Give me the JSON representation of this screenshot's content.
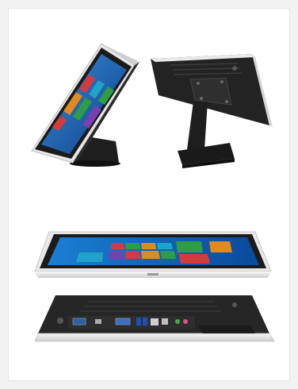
{
  "product": {
    "views": [
      {
        "name": "angled-front-view"
      },
      {
        "name": "angled-rear-view"
      },
      {
        "name": "flat-front-view"
      },
      {
        "name": "rear-ports-view"
      }
    ]
  },
  "colors": {
    "bezel": "#1b1b1b",
    "frame": "#e8e8e8",
    "stand": "#1e1e1e",
    "screen_blue": "#1a5fb4",
    "tile_green": "#2e9e44",
    "tile_red": "#d63b3b",
    "tile_purple": "#7a3fb0",
    "tile_orange": "#e38a1e",
    "tile_cyan": "#1fa3c9"
  }
}
